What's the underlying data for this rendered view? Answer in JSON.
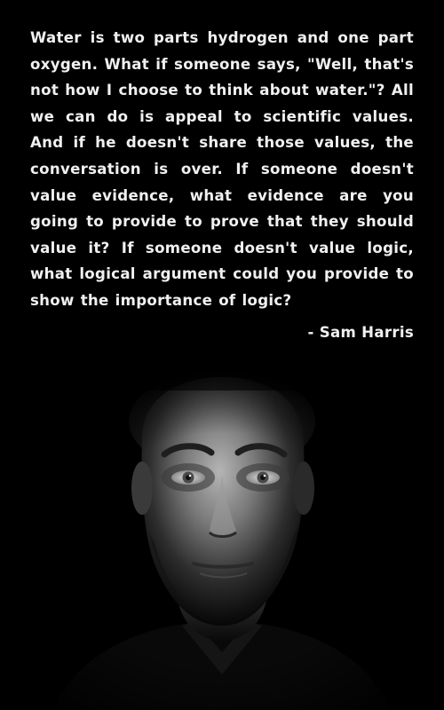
{
  "quote": {
    "text": "Water is two parts hydrogen and one part oxygen. What if someone says, \"Well, that's not how I choose to think about water.\"? All we can do is appeal to scientific values. And if he doesn't share those values, the conversation is over. If someone doesn't value evidence, what evidence are you going to provide to prove that they should value it? If someone doesn't value logic, what logical argument could you provide to show the importance of logic?",
    "attribution": "- Sam Harris"
  },
  "colors": {
    "background": "#000000",
    "text": "#f0f0f0"
  }
}
